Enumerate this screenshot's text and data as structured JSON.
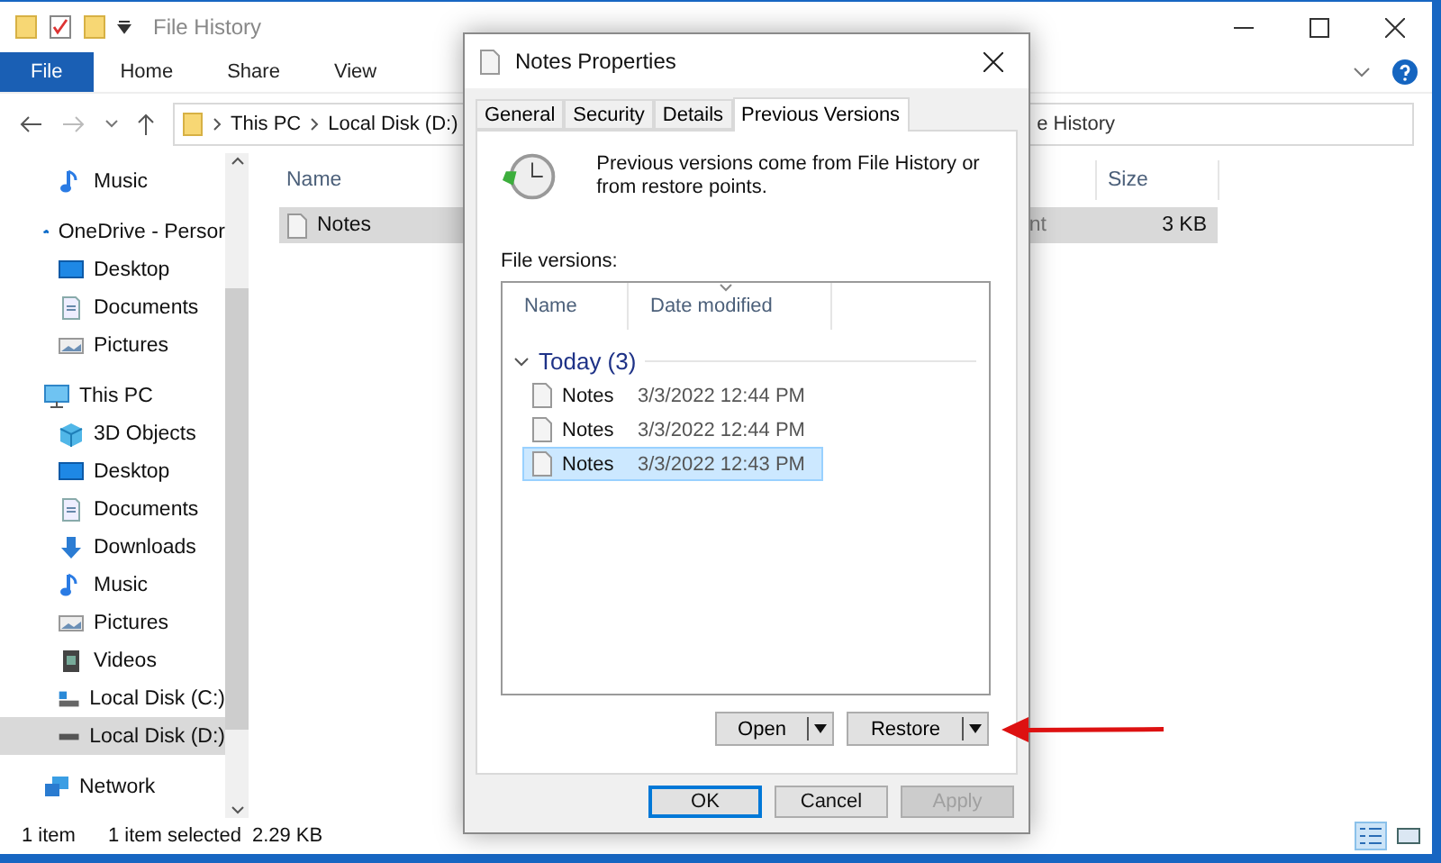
{
  "explorer": {
    "title": "File History",
    "ribbon_tabs": [
      {
        "label": "File",
        "kind": "menu"
      },
      {
        "label": "Home",
        "kind": "tab"
      },
      {
        "label": "Share",
        "kind": "tab"
      },
      {
        "label": "View",
        "kind": "tab"
      }
    ],
    "address": [
      "This PC",
      "Local Disk (D:)"
    ],
    "address_tail": "e History",
    "nav_tree": [
      {
        "children": [
          {
            "label": "Music",
            "kind": "music",
            "selected": false
          }
        ]
      },
      {
        "label": "OneDrive - Persor",
        "kind": "cloud",
        "selected": false,
        "children": [
          {
            "label": "Desktop",
            "kind": "desktop",
            "selected": false
          },
          {
            "label": "Documents",
            "kind": "documents",
            "selected": false
          },
          {
            "label": "Pictures",
            "kind": "pictures",
            "selected": false
          }
        ]
      },
      {
        "label": "This PC",
        "kind": "pc",
        "selected": false,
        "children": [
          {
            "label": "3D Objects",
            "kind": "objects",
            "selected": false
          },
          {
            "label": "Desktop",
            "kind": "desktop",
            "selected": false
          },
          {
            "label": "Documents",
            "kind": "documents",
            "selected": false
          },
          {
            "label": "Downloads",
            "kind": "downloads",
            "selected": false
          },
          {
            "label": "Music",
            "kind": "music",
            "selected": false
          },
          {
            "label": "Pictures",
            "kind": "pictures",
            "selected": false
          },
          {
            "label": "Videos",
            "kind": "videos",
            "selected": false
          },
          {
            "label": "Local Disk (C:)",
            "kind": "systemdrive",
            "selected": false
          },
          {
            "label": "Local Disk (D:)",
            "kind": "drive",
            "selected": true
          }
        ]
      },
      {
        "label": "Network",
        "kind": "network",
        "selected": false
      }
    ],
    "columns": [
      "Name",
      "Size"
    ],
    "files": [
      {
        "name": "Notes",
        "type": "nt",
        "size": "3 KB",
        "selected": true
      }
    ],
    "status": {
      "count": "1 item",
      "selection": "1 item selected",
      "size": "2.29 KB"
    }
  },
  "dialog": {
    "title": "Notes Properties",
    "tabs": [
      {
        "label": "General",
        "selected": false
      },
      {
        "label": "Security",
        "selected": false
      },
      {
        "label": "Details",
        "selected": false
      },
      {
        "label": "Previous Versions",
        "selected": true
      }
    ],
    "info": "Previous versions come from File History or from restore points.",
    "list_label": "File versions:",
    "columns": [
      "Name",
      "Date modified"
    ],
    "groups": [
      {
        "label": "Today (3)",
        "expanded": true,
        "items": [
          {
            "name": "Notes",
            "date": "3/3/2022 12:44 PM",
            "selected": false
          },
          {
            "name": "Notes",
            "date": "3/3/2022 12:44 PM",
            "selected": false
          },
          {
            "name": "Notes",
            "date": "3/3/2022 12:43 PM",
            "selected": true
          }
        ]
      }
    ],
    "actions": [
      {
        "label": "Open"
      },
      {
        "label": "Restore"
      }
    ],
    "buttons": [
      {
        "label": "OK",
        "kind": "default",
        "disabled": false
      },
      {
        "label": "Cancel",
        "kind": "normal",
        "disabled": false
      },
      {
        "label": "Apply",
        "kind": "normal",
        "disabled": true
      }
    ]
  }
}
